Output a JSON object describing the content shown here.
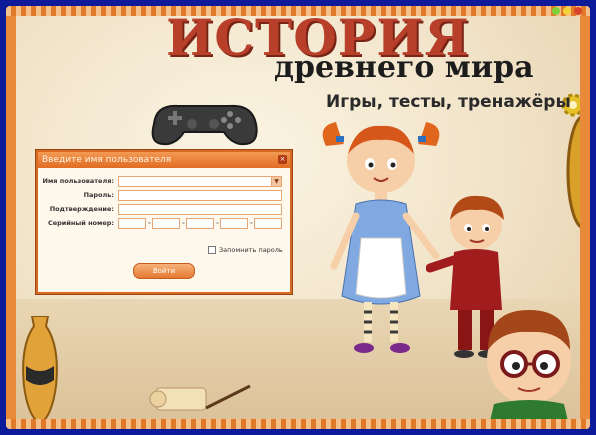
{
  "title": {
    "main": "ИСТОРИЯ",
    "sub": "древнего мира",
    "tagline": "Игры, тесты, тренажёры"
  },
  "window_controls": [
    "minimize-icon",
    "maximize-icon",
    "close-icon"
  ],
  "login_dialog": {
    "title": "Введите имя пользователя",
    "username_label": "Имя пользователя:",
    "username_value": "",
    "password_label": "Пароль:",
    "password_value": "",
    "confirm_label": "Подтверждение:",
    "confirm_value": "",
    "serial_label": "Серийный номер:",
    "serial_parts": [
      "",
      "",
      "",
      "",
      ""
    ],
    "serial_separator": "-",
    "remember_label": "Запомнить пароль",
    "remember_checked": false,
    "login_button": "Войти"
  },
  "colors": {
    "frame": "#e98a3a",
    "outer_background": "#0d1a9a",
    "title_red": "#b8402a",
    "dialog_header": "#e06c22"
  }
}
